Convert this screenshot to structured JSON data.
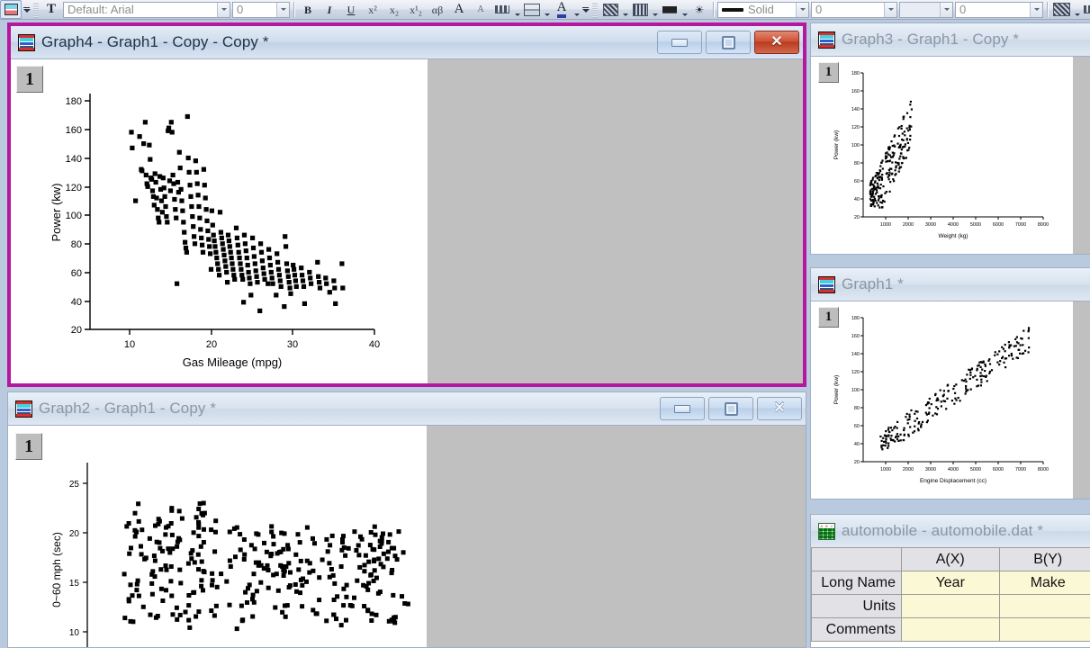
{
  "toolbar": {
    "font_combo": {
      "value": "Default: Arial",
      "name": "font-name-combo"
    },
    "size_combo": {
      "value": "0",
      "name": "font-size-combo"
    },
    "bold": "B",
    "italic": "I",
    "underline": "U",
    "superscript": "x²",
    "subscript": "x₂",
    "subsuperscript": "x¹₂",
    "greek": "αβ",
    "increase_font": "A",
    "decrease_font": "A",
    "line_style_value": "Solid",
    "line_width_value": "0",
    "fill_value": "0"
  },
  "windows": [
    {
      "title": "Graph4 - Graph1 - Copy - Copy *",
      "active": true,
      "layer": "1",
      "buttons": {
        "minimize": "minimize",
        "maximize": "maximize",
        "close": "close"
      }
    },
    {
      "title": "Graph2 - Graph1 - Copy *",
      "active": false,
      "layer": "1",
      "buttons": {
        "minimize": "minimize",
        "maximize": "maximize",
        "close": "close"
      }
    },
    {
      "title": "Graph3 - Graph1 - Copy *",
      "active": false,
      "layer": "1"
    },
    {
      "title": "Graph1 *",
      "active": false,
      "layer": "1"
    },
    {
      "title": "automobile - automobile.dat *",
      "active": false
    }
  ],
  "worksheet": {
    "title": "automobile - automobile.dat *",
    "columns": [
      "",
      "A(X)",
      "B(Y)"
    ],
    "rows": [
      {
        "header": "Long Name",
        "cells": [
          "Year",
          "Make"
        ]
      },
      {
        "header": "Units",
        "cells": [
          "",
          ""
        ]
      },
      {
        "header": "Comments",
        "cells": [
          "",
          ""
        ]
      }
    ]
  },
  "chart_data": [
    {
      "id": "graph4",
      "type": "scatter",
      "title": "",
      "xlabel": "Gas Mileage (mpg)",
      "ylabel": "Power (kw)",
      "xlim": [
        5,
        40
      ],
      "ylim": [
        20,
        180
      ],
      "xticks": [
        10,
        20,
        30,
        40
      ],
      "yticks": [
        20,
        40,
        60,
        80,
        100,
        120,
        140,
        160,
        180
      ],
      "grid": false,
      "legend": "none",
      "marker": "square-filled-black",
      "points": [
        [
          10.1,
          158
        ],
        [
          10.2,
          147
        ],
        [
          10.6,
          110
        ],
        [
          11.1,
          155
        ],
        [
          11.3,
          132
        ],
        [
          11.4,
          131
        ],
        [
          11.6,
          150
        ],
        [
          11.8,
          165
        ],
        [
          11.9,
          128
        ],
        [
          12.0,
          122
        ],
        [
          12.1,
          120
        ],
        [
          12.3,
          149
        ],
        [
          12.4,
          139
        ],
        [
          12.5,
          126
        ],
        [
          12.6,
          125
        ],
        [
          12.7,
          117
        ],
        [
          12.8,
          113
        ],
        [
          12.9,
          107
        ],
        [
          13.0,
          129
        ],
        [
          13.1,
          123
        ],
        [
          13.2,
          112
        ],
        [
          13.3,
          104
        ],
        [
          13.4,
          98
        ],
        [
          13.5,
          95
        ],
        [
          13.6,
          127
        ],
        [
          13.7,
          118
        ],
        [
          13.8,
          110
        ],
        [
          13.9,
          102
        ],
        [
          14.0,
          126
        ],
        [
          14.1,
          119
        ],
        [
          14.2,
          113
        ],
        [
          14.3,
          106
        ],
        [
          14.4,
          99
        ],
        [
          14.5,
          95
        ],
        [
          14.6,
          159
        ],
        [
          14.7,
          161
        ],
        [
          14.8,
          124
        ],
        [
          14.9,
          117
        ],
        [
          15.0,
          165
        ],
        [
          15.1,
          158
        ],
        [
          15.2,
          128
        ],
        [
          15.3,
          122
        ],
        [
          15.4,
          111
        ],
        [
          15.5,
          104
        ],
        [
          15.6,
          98
        ],
        [
          15.7,
          52
        ],
        [
          15.8,
          123
        ],
        [
          15.9,
          116
        ],
        [
          16.0,
          144
        ],
        [
          16.1,
          133
        ],
        [
          16.2,
          118
        ],
        [
          16.3,
          110
        ],
        [
          16.4,
          103
        ],
        [
          16.5,
          95
        ],
        [
          16.6,
          88
        ],
        [
          16.7,
          81
        ],
        [
          16.8,
          77
        ],
        [
          16.9,
          74
        ],
        [
          17.0,
          169
        ],
        [
          17.1,
          140
        ],
        [
          17.2,
          130
        ],
        [
          17.3,
          121
        ],
        [
          17.4,
          113
        ],
        [
          17.5,
          106
        ],
        [
          17.6,
          99
        ],
        [
          17.7,
          92
        ],
        [
          17.8,
          85
        ],
        [
          17.9,
          80
        ],
        [
          18.0,
          138
        ],
        [
          18.1,
          130
        ],
        [
          18.2,
          122
        ],
        [
          18.3,
          114
        ],
        [
          18.4,
          106
        ],
        [
          18.5,
          98
        ],
        [
          18.6,
          90
        ],
        [
          18.7,
          84
        ],
        [
          18.8,
          79
        ],
        [
          18.9,
          74
        ],
        [
          19.0,
          132
        ],
        [
          19.1,
          121
        ],
        [
          19.2,
          112
        ],
        [
          19.3,
          104
        ],
        [
          19.4,
          96
        ],
        [
          19.5,
          89
        ],
        [
          19.6,
          83
        ],
        [
          19.7,
          78
        ],
        [
          19.8,
          73
        ],
        [
          19.9,
          62
        ],
        [
          20.0,
          103
        ],
        [
          20.1,
          93
        ],
        [
          20.2,
          86
        ],
        [
          20.3,
          82
        ],
        [
          20.4,
          78
        ],
        [
          20.5,
          74
        ],
        [
          20.6,
          70
        ],
        [
          20.7,
          66
        ],
        [
          20.8,
          62
        ],
        [
          20.9,
          58
        ],
        [
          21.0,
          102
        ],
        [
          21.1,
          88
        ],
        [
          21.2,
          84
        ],
        [
          21.3,
          80
        ],
        [
          21.4,
          76
        ],
        [
          21.5,
          72
        ],
        [
          21.6,
          68
        ],
        [
          21.7,
          64
        ],
        [
          21.8,
          60
        ],
        [
          21.9,
          53
        ],
        [
          22.0,
          86
        ],
        [
          22.1,
          82
        ],
        [
          22.2,
          78
        ],
        [
          22.3,
          74
        ],
        [
          22.4,
          70
        ],
        [
          22.5,
          66
        ],
        [
          22.6,
          62
        ],
        [
          22.7,
          58
        ],
        [
          22.8,
          55
        ],
        [
          23.0,
          91
        ],
        [
          23.1,
          84
        ],
        [
          23.2,
          79
        ],
        [
          23.3,
          74
        ],
        [
          23.4,
          70
        ],
        [
          23.5,
          66
        ],
        [
          23.6,
          62
        ],
        [
          23.7,
          58
        ],
        [
          23.8,
          55
        ],
        [
          23.9,
          39
        ],
        [
          24.0,
          86
        ],
        [
          24.1,
          80
        ],
        [
          24.2,
          75
        ],
        [
          24.3,
          70
        ],
        [
          24.4,
          65
        ],
        [
          24.5,
          60
        ],
        [
          24.6,
          56
        ],
        [
          24.7,
          52
        ],
        [
          24.8,
          44
        ],
        [
          25.0,
          84
        ],
        [
          25.1,
          77
        ],
        [
          25.2,
          71
        ],
        [
          25.3,
          66
        ],
        [
          25.4,
          61
        ],
        [
          25.5,
          57
        ],
        [
          25.6,
          53
        ],
        [
          25.9,
          33
        ],
        [
          26.0,
          80
        ],
        [
          26.1,
          74
        ],
        [
          26.2,
          68
        ],
        [
          26.3,
          63
        ],
        [
          26.4,
          59
        ],
        [
          26.5,
          55
        ],
        [
          26.9,
          52
        ],
        [
          27.0,
          76
        ],
        [
          27.1,
          70
        ],
        [
          27.2,
          65
        ],
        [
          27.3,
          60
        ],
        [
          27.4,
          56
        ],
        [
          27.5,
          52
        ],
        [
          27.9,
          44
        ],
        [
          28.0,
          73
        ],
        [
          28.1,
          67
        ],
        [
          28.2,
          62
        ],
        [
          28.3,
          58
        ],
        [
          28.4,
          54
        ],
        [
          28.5,
          50
        ],
        [
          28.9,
          36
        ],
        [
          29.0,
          85
        ],
        [
          29.1,
          78
        ],
        [
          29.2,
          66
        ],
        [
          29.3,
          61
        ],
        [
          29.4,
          57
        ],
        [
          29.5,
          53
        ],
        [
          29.6,
          49
        ],
        [
          29.7,
          45
        ],
        [
          30.0,
          65
        ],
        [
          30.1,
          62
        ],
        [
          30.2,
          58
        ],
        [
          30.3,
          54
        ],
        [
          30.4,
          50
        ],
        [
          31.0,
          63
        ],
        [
          31.1,
          58
        ],
        [
          31.2,
          54
        ],
        [
          31.3,
          50
        ],
        [
          31.4,
          38
        ],
        [
          32.0,
          60
        ],
        [
          32.1,
          56
        ],
        [
          32.2,
          52
        ],
        [
          33.0,
          67
        ],
        [
          33.1,
          57
        ],
        [
          33.2,
          53
        ],
        [
          33.3,
          49
        ],
        [
          34.0,
          56
        ],
        [
          34.1,
          52
        ],
        [
          34.5,
          46
        ],
        [
          35.0,
          54
        ],
        [
          35.1,
          49
        ],
        [
          35.2,
          38
        ],
        [
          36.0,
          66
        ],
        [
          36.1,
          49
        ]
      ]
    },
    {
      "id": "graph2",
      "type": "scatter",
      "title": "",
      "xlabel": "",
      "ylabel": "0~60 mph (sec)",
      "ylim": [
        9,
        27
      ],
      "yticks": [
        10,
        15,
        20,
        25
      ],
      "grid": false,
      "marker": "square-filled-black"
    },
    {
      "id": "graph3",
      "type": "scatter",
      "title": "",
      "xlabel": "Weight (kg)",
      "ylabel": "Power (kw)",
      "xlim": [
        400,
        8000
      ],
      "ylim": [
        20,
        180
      ],
      "xticks": [
        1000,
        2000,
        3000,
        4000,
        5000,
        6000,
        7000,
        8000
      ],
      "yticks": [
        20,
        40,
        60,
        80,
        100,
        120,
        140,
        160,
        180
      ],
      "grid": false,
      "marker": "square-filled-black"
    },
    {
      "id": "graph1",
      "type": "scatter",
      "title": "",
      "xlabel": "Engine Displacement (cc)",
      "ylabel": "Power (kw)",
      "xlim": [
        400,
        8000
      ],
      "ylim": [
        20,
        180
      ],
      "xticks": [
        1000,
        2000,
        3000,
        4000,
        5000,
        6000,
        7000,
        8000
      ],
      "yticks": [
        20,
        40,
        60,
        80,
        100,
        120,
        140,
        160,
        180
      ],
      "grid": false,
      "marker": "square-filled-black"
    }
  ]
}
